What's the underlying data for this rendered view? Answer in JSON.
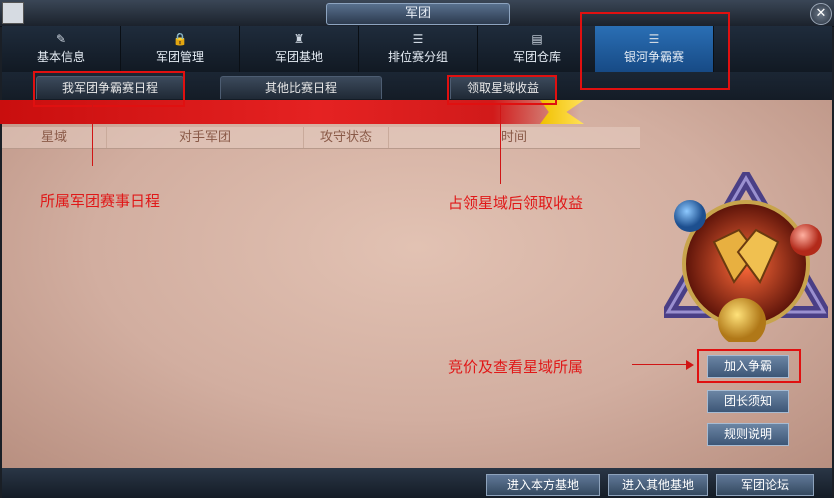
{
  "window": {
    "title": "军团"
  },
  "tabs": [
    {
      "label": "基本信息",
      "icon": "pencil-icon",
      "glyph": "✎"
    },
    {
      "label": "军团管理",
      "icon": "lock-icon",
      "glyph": "🔒"
    },
    {
      "label": "军团基地",
      "icon": "castle-icon",
      "glyph": "♜"
    },
    {
      "label": "排位赛分组",
      "icon": "list-icon",
      "glyph": "☰"
    },
    {
      "label": "军团仓库",
      "icon": "storage-icon",
      "glyph": "▤"
    },
    {
      "label": "银河争霸赛",
      "icon": "list-icon",
      "glyph": "☰"
    }
  ],
  "subtabs": [
    "我军团争霸赛日程",
    "其他比赛日程",
    "领取星域收益"
  ],
  "columns": [
    "星域",
    "对手军团",
    "攻守状态",
    "时间"
  ],
  "annotations": {
    "schedule": "所属军团赛事日程",
    "income": "占领星域后领取收益",
    "bid": "竞价及查看星域所属"
  },
  "side_buttons": [
    "加入争霸",
    "团长须知",
    "规则说明"
  ],
  "bottom_buttons": [
    "进入本方基地",
    "进入其他基地",
    "军团论坛"
  ],
  "colors": {
    "accent_red": "#e01818",
    "active_tab": "#2a6fb5",
    "banner": "#d91818"
  }
}
